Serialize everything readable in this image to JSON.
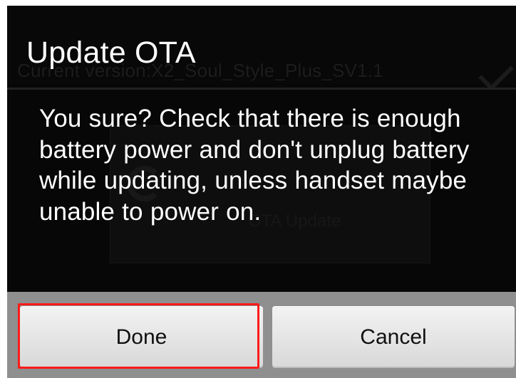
{
  "background": {
    "status_text": "Current version:X2_Soul_Style_Plus_SV1.1",
    "check_icon": "check-icon",
    "panel_text": "OTA Update"
  },
  "dialog": {
    "title": "Update OTA",
    "message": "You sure? Check that there is enough battery power and don't unplug battery while updating, unless handset maybe unable to power on.",
    "buttons": {
      "done": "Done",
      "cancel": "Cancel"
    }
  },
  "colors": {
    "dialog_background": "#070707",
    "button_bar": "#8f8f8f",
    "button_background": "#e6e6e6",
    "highlight": "#ff1b1b"
  }
}
